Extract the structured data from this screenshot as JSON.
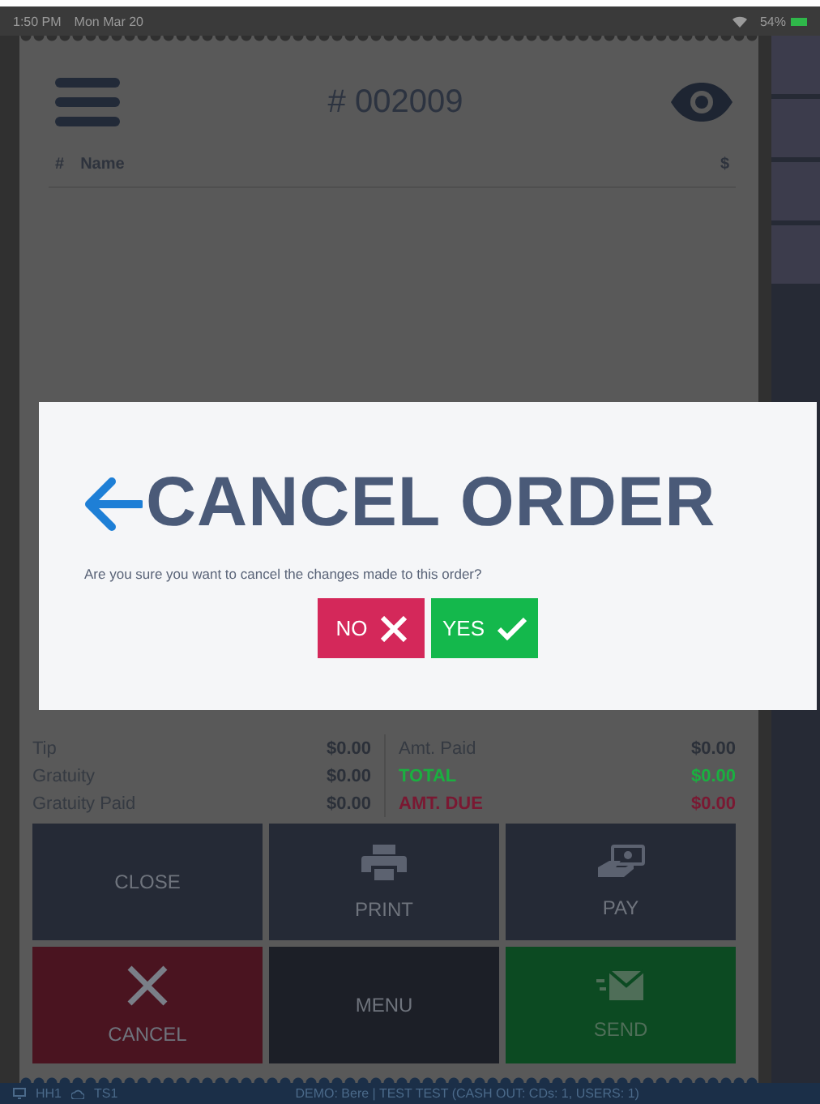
{
  "status_bar": {
    "time": "1:50 PM",
    "date": "Mon Mar 20",
    "battery": "54%"
  },
  "order": {
    "number": "# 002009",
    "columns": [
      "#",
      "Name",
      "$"
    ]
  },
  "totals": [
    {
      "left_label": "Tip",
      "left_value": "$0.00",
      "right_label": "Amt. Paid",
      "right_value": "$0.00",
      "kind": "normal"
    },
    {
      "left_label": "Gratuity",
      "left_value": "$0.00",
      "right_label": "TOTAL",
      "right_value": "$0.00",
      "kind": "total"
    },
    {
      "left_label": "Gratuity Paid",
      "left_value": "$0.00",
      "right_label": "AMT. DUE",
      "right_value": "$0.00",
      "kind": "due"
    }
  ],
  "actions": [
    {
      "label": "CLOSE",
      "kind": "close"
    },
    {
      "label": "PRINT",
      "kind": "print"
    },
    {
      "label": "PAY",
      "kind": "pay"
    },
    {
      "label": "CANCEL",
      "kind": "cancel"
    },
    {
      "label": "MENU",
      "kind": "menu"
    },
    {
      "label": "SEND",
      "kind": "send"
    }
  ],
  "dialog": {
    "title": "CANCEL ORDER",
    "message": "Are you sure you want to cancel the changes made to this order?",
    "buttons": [
      {
        "label": "NO",
        "kind": "no"
      },
      {
        "label": "YES",
        "kind": "yes"
      }
    ]
  },
  "footer": {
    "device": "HH1",
    "terminal": "TS1",
    "info": "DEMO: Bere | TEST TEST (CASH OUT: CDs: 1, USERS: 1)"
  }
}
